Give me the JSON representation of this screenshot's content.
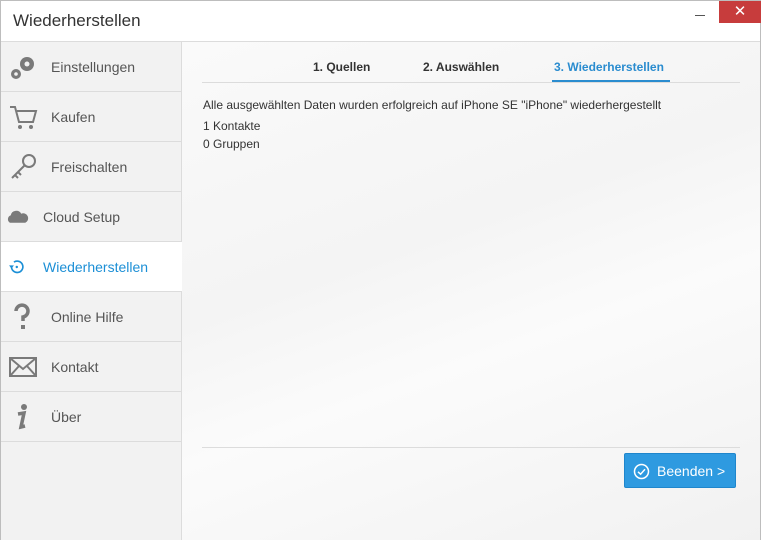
{
  "window": {
    "title": "Wiederherstellen",
    "close_glyph": "✕"
  },
  "sidebar": {
    "items": [
      {
        "label": "Einstellungen",
        "icon": "gears-icon"
      },
      {
        "label": "Kaufen",
        "icon": "cart-icon"
      },
      {
        "label": "Freischalten",
        "icon": "key-icon"
      },
      {
        "label": "Cloud Setup",
        "icon": "cloud-icon"
      },
      {
        "label": "Wiederherstellen",
        "icon": "restore-icon",
        "active": true
      },
      {
        "label": "Online Hilfe",
        "icon": "question-icon"
      },
      {
        "label": "Kontakt",
        "icon": "envelope-icon"
      },
      {
        "label": "Über",
        "icon": "info-icon"
      }
    ]
  },
  "tabs": [
    {
      "label": "1. Quellen"
    },
    {
      "label": "2. Auswählen"
    },
    {
      "label": "3. Wiederherstellen",
      "active": true
    }
  ],
  "main": {
    "message": "Alle ausgewählten Daten wurden erfolgreich auf iPhone SE \"iPhone\" wiederhergestellt",
    "contacts": "1 Kontakte",
    "groups": "0 Gruppen"
  },
  "footer": {
    "finish_label": "Beenden >"
  },
  "colors": {
    "accent": "#2e9ae0",
    "close": "#c73c3c"
  }
}
